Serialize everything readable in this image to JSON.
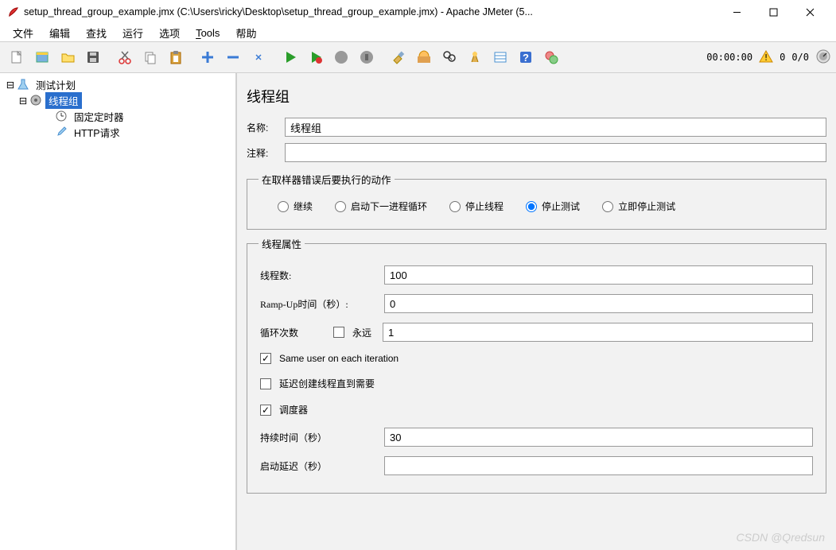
{
  "window": {
    "title": "setup_thread_group_example.jmx (C:\\Users\\ricky\\Desktop\\setup_thread_group_example.jmx) - Apache JMeter (5..."
  },
  "menu": {
    "file": "文件",
    "edit": "编辑",
    "find": "查找",
    "run": "运行",
    "options": "选项",
    "tools": "Tools",
    "help": "帮助"
  },
  "toolbar_status": {
    "time": "00:00:00",
    "active": "0",
    "totals": "0/0"
  },
  "tree": {
    "plan": "测试计划",
    "thread_group": "线程组",
    "timer": "固定定时器",
    "http": "HTTP请求"
  },
  "panel": {
    "title": "线程组",
    "name_label": "名称:",
    "name_value": "线程组",
    "comment_label": "注释:",
    "comment_value": ""
  },
  "error_group": {
    "legend": "在取样器错误后要执行的动作",
    "continue": "继续",
    "next_loop": "启动下一进程循环",
    "stop_thread": "停止线程",
    "stop_test": "停止测试",
    "stop_now": "立即停止测试"
  },
  "props": {
    "legend": "线程属性",
    "threads_label": "线程数:",
    "threads_value": "100",
    "ramp_label": "Ramp-Up时间（秒）:",
    "ramp_value": "0",
    "loop_label": "循环次数",
    "forever_label": "永远",
    "loop_value": "1",
    "same_user": "Same user on each iteration",
    "delay_create": "延迟创建线程直到需要",
    "scheduler": "调度器",
    "duration_label": "持续时间（秒）",
    "duration_value": "30",
    "startup_delay_label": "启动延迟（秒）",
    "startup_delay_value": ""
  },
  "watermark": "CSDN @Qredsun",
  "icons": {
    "new": "new-file-icon",
    "templates": "templates-icon",
    "open": "open-icon",
    "save": "save-icon",
    "cut": "cut-icon",
    "copy": "copy-icon",
    "paste": "paste-icon",
    "plus": "plus-icon",
    "minus": "minus-icon",
    "toggle": "expand-icon",
    "start": "start-icon",
    "start_no": "start-no-timers-icon",
    "stop": "stop-icon",
    "shutdown": "shutdown-icon",
    "clear": "clear-icon",
    "clear_all": "clear-all-icon",
    "search": "search-icon",
    "reset_search": "reset-search-icon",
    "fn": "function-helper-icon",
    "help": "help-icon",
    "whatsthis": "whats-this-icon",
    "warn": "warning-icon",
    "gauge": "gauge-icon"
  }
}
